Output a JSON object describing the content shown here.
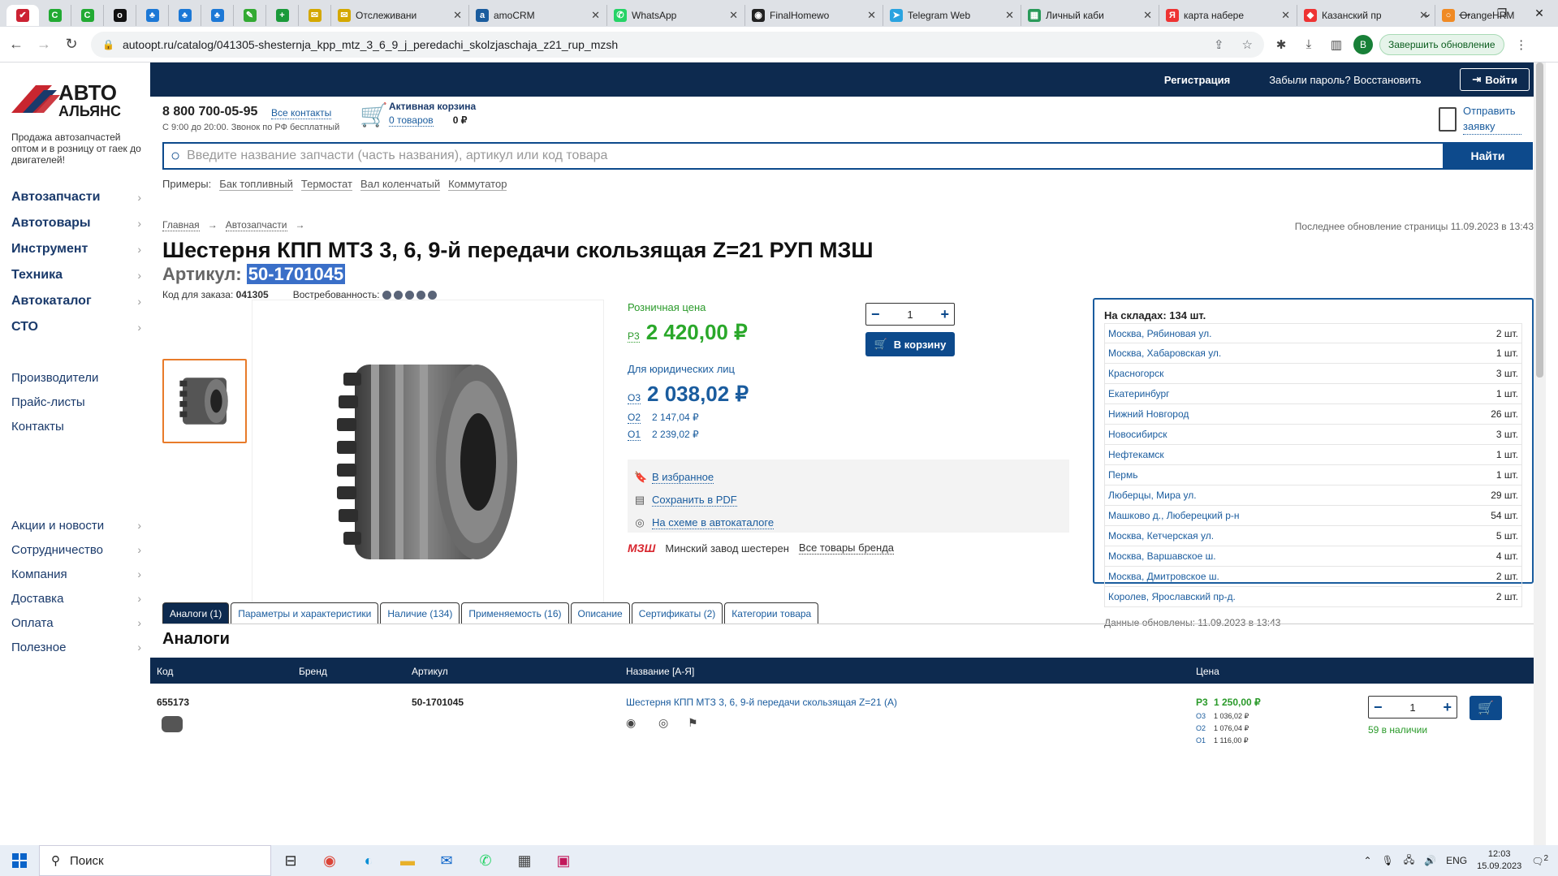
{
  "browser": {
    "tabs": [
      {
        "kind": "mini",
        "color": "#c23",
        "glyph": "✔"
      },
      {
        "kind": "mini",
        "color": "#2a3",
        "glyph": "C"
      },
      {
        "kind": "mini",
        "color": "#2a3",
        "glyph": "C"
      },
      {
        "kind": "mini",
        "color": "#111",
        "glyph": "o"
      },
      {
        "kind": "mini",
        "color": "#1c78d6",
        "glyph": "♣"
      },
      {
        "kind": "mini",
        "color": "#1c78d6",
        "glyph": "♣"
      },
      {
        "kind": "mini",
        "color": "#1c78d6",
        "glyph": "♣"
      },
      {
        "kind": "mini",
        "color": "#3a3",
        "glyph": "✎"
      },
      {
        "kind": "mini",
        "color": "#1a9a3a",
        "glyph": "+"
      },
      {
        "kind": "mini",
        "color": "#d4a800",
        "glyph": "✉"
      },
      {
        "kind": "wide",
        "color": "#d4a800",
        "glyph": "✉",
        "title": "Отслеживани"
      },
      {
        "kind": "wide",
        "color": "#1a5c9e",
        "glyph": "a",
        "title": "amoCRM"
      },
      {
        "kind": "wide",
        "color": "#25d366",
        "glyph": "✆",
        "title": "WhatsApp"
      },
      {
        "kind": "wide",
        "color": "#222",
        "glyph": "◉",
        "title": "FinalHomewo"
      },
      {
        "kind": "wide",
        "color": "#2aa3e0",
        "glyph": "➤",
        "title": "Telegram Web"
      },
      {
        "kind": "wide",
        "color": "#2a9a5a",
        "glyph": "▦",
        "title": "Личный каби"
      },
      {
        "kind": "wide",
        "color": "#e33",
        "glyph": "Я",
        "title": "карта набере"
      },
      {
        "kind": "wide",
        "color": "#e33",
        "glyph": "◆",
        "title": "Казанский пр"
      },
      {
        "kind": "wide",
        "color": "#f08a24",
        "glyph": "○",
        "title": "OrangeHRM"
      }
    ],
    "url": "autoopt.ru/catalog/041305-shesternja_kpp_mtz_3_6_9_j_peredachi_skolzjaschaja_z21_rup_mzsh",
    "avatar": "В",
    "update_label": "Завершить обновление"
  },
  "site": {
    "logo_top": "АВТО",
    "logo_bottom": "АЛЬЯНС",
    "tagline": "Продажа автозапчастей оптом и в розницу от гаек до двигателей!",
    "menu_main": [
      "Автозапчасти",
      "Автотовары",
      "Инструмент",
      "Техника",
      "Автокаталог",
      "СТО"
    ],
    "menu_sub": [
      "Производители",
      "Прайс-листы",
      "Контакты"
    ],
    "menu_sub2": [
      "Акции и новости",
      "Сотрудничество",
      "Компания",
      "Доставка",
      "Оплата",
      "Полезное"
    ],
    "topnav": {
      "register": "Регистрация",
      "forgot": "Забыли пароль? Восстановить",
      "login": "Войти"
    },
    "phone": "8 800 700-05-95",
    "all_contacts": "Все контакты",
    "hours": "С 9:00 до 20:00. Звонок по РФ бесплатный",
    "cart": {
      "title": "Активная корзина",
      "count": "0 товаров",
      "sum": "0 ₽"
    },
    "send_request": "Отправить заявку",
    "search": {
      "placeholder": "Введите название запчасти (часть названия), артикул или код товара",
      "button": "Найти"
    },
    "examples_label": "Примеры:",
    "examples": [
      "Бак топливный",
      "Термостат",
      "Вал коленчатый",
      "Коммутатор"
    ]
  },
  "product": {
    "crumbs": [
      "Главная",
      "Автозапчасти"
    ],
    "last_update": "Последнее обновление страницы 11.09.2023 в 13:43",
    "title": "Шестерня КПП МТЗ 3, 6, 9-й передачи скользящая Z=21 РУП МЗШ",
    "partno_label": "Артикул:",
    "partno": "50-1701045",
    "order_code_label": "Код для заказа:",
    "order_code": "041305",
    "demand_label": "Востребованность:",
    "demand_level": 5,
    "retail_label": "Розничная цена",
    "retail_tag": "Р3",
    "retail_price": "2 420,00 ₽",
    "legal_label": "Для юридических лиц",
    "legal_tag": "О3",
    "legal_price": "2 038,02 ₽",
    "o2_tag": "О2",
    "o2_price": "2 147,04 ₽",
    "o1_tag": "О1",
    "o1_price": "2 239,02 ₽",
    "qty": "1",
    "to_cart": "В корзину",
    "actions": [
      "В избранное",
      "Сохранить в PDF",
      "На схеме в автокаталоге"
    ],
    "brand_logo": "МЗШ",
    "brand_name": "Минский завод шестерен",
    "brand_all": "Все товары бренда"
  },
  "stock": {
    "header": "На складах: 134 шт.",
    "rows": [
      {
        "name": "Москва, Рябиновая ул.",
        "qty": "2 шт."
      },
      {
        "name": "Москва, Хабаровская ул.",
        "qty": "1 шт."
      },
      {
        "name": "Красногорск",
        "qty": "3 шт."
      },
      {
        "name": "Екатеринбург",
        "qty": "1 шт."
      },
      {
        "name": "Нижний Новгород",
        "qty": "26 шт."
      },
      {
        "name": "Новосибирск",
        "qty": "3 шт."
      },
      {
        "name": "Нефтекамск",
        "qty": "1 шт."
      },
      {
        "name": "Пермь",
        "qty": "1 шт."
      },
      {
        "name": "Люберцы, Мира ул.",
        "qty": "29 шт."
      },
      {
        "name": "Машково д., Люберецкий р-н",
        "qty": "54 шт."
      },
      {
        "name": "Москва, Кетчерская ул.",
        "qty": "5 шт."
      },
      {
        "name": "Москва, Варшавское ш.",
        "qty": "4 шт."
      },
      {
        "name": "Москва, Дмитровское ш.",
        "qty": "2 шт."
      },
      {
        "name": "Королев, Ярославский пр-д.",
        "qty": "2 шт."
      }
    ],
    "updated": "Данные обновлены: 11.09.2023 в 13:43"
  },
  "tabs": [
    "Аналоги (1)",
    "Параметры и характеристики",
    "Наличие (134)",
    "Применяемость (16)",
    "Описание",
    "Сертификаты (2)",
    "Категории товара"
  ],
  "analogs": {
    "heading": "Аналоги",
    "columns": [
      "Код",
      "Бренд",
      "Артикул",
      "Название [А-Я]",
      "Цена"
    ],
    "row": {
      "code": "655173",
      "partno": "50-1701045",
      "name": "Шестерня КПП МТЗ 3, 6, 9-й передачи скользящая Z=21 (А)",
      "p3_tag": "Р3",
      "p3": "1 250,00 ₽",
      "o3_tag": "О3",
      "o3": "1 036,02 ₽",
      "o2_tag": "О2",
      "o2": "1 076,04 ₽",
      "o1_tag": "О1",
      "o1": "1 116,00 ₽",
      "qty": "1",
      "instock": "59 в наличии"
    }
  },
  "taskbar": {
    "search": "Поиск",
    "lang": "ENG",
    "time": "12:03",
    "date": "15.09.2023",
    "notif": "2"
  }
}
